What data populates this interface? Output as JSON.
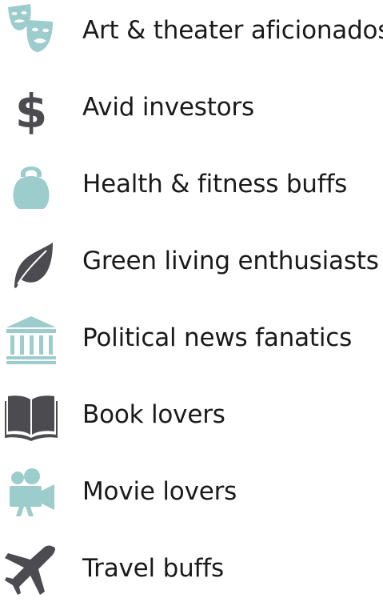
{
  "colors": {
    "teal": "#9ccccb",
    "dark": "#4b4b50",
    "text": "#1a1a1a"
  },
  "items": [
    {
      "icon": "theater-masks-icon",
      "label": "Art & theater aficionados"
    },
    {
      "icon": "dollar-sign-icon",
      "label": "Avid investors"
    },
    {
      "icon": "kettlebell-icon",
      "label": "Health & fitness buffs"
    },
    {
      "icon": "leaf-icon",
      "label": "Green living enthusiasts"
    },
    {
      "icon": "government-building-icon",
      "label": "Political news fanatics"
    },
    {
      "icon": "open-book-icon",
      "label": "Book lovers"
    },
    {
      "icon": "movie-camera-icon",
      "label": "Movie lovers"
    },
    {
      "icon": "airplane-icon",
      "label": "Travel buffs"
    }
  ]
}
